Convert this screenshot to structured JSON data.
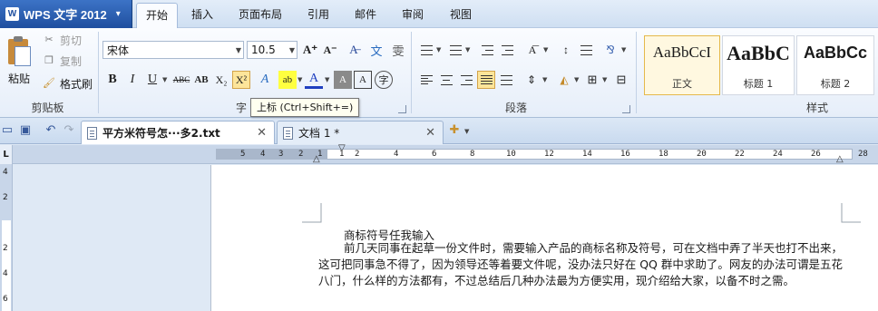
{
  "app": {
    "title": "WPS 文字 2012",
    "logo_text": "W"
  },
  "menu": {
    "tabs": [
      "开始",
      "插入",
      "页面布局",
      "引用",
      "邮件",
      "审阅",
      "视图"
    ],
    "active": "开始"
  },
  "clipboard": {
    "paste": "粘贴",
    "cut": "剪切",
    "copy": "复制",
    "format_painter": "格式刷",
    "group": "剪贴板"
  },
  "font": {
    "name": "宋体",
    "size": "10.5",
    "group": "字",
    "bold": "B",
    "italic": "I",
    "underline": "U",
    "abc": "ABC",
    "strike": "AB",
    "subscript": "X₂",
    "superscript": "X²",
    "grow": "A⁺",
    "shrink": "A⁻",
    "color_a": "A"
  },
  "paragraph": {
    "group": "段落"
  },
  "styles": {
    "group": "样式",
    "items": [
      {
        "sample": "AaBbCcI",
        "name": "正文"
      },
      {
        "sample": "AaBbC",
        "name": "标题 1"
      },
      {
        "sample": "AaBbCc",
        "name": "标题 2"
      }
    ]
  },
  "tooltip": "上标 (Ctrl+Shift+=)",
  "doc_tabs": [
    {
      "title": "平方米符号怎···多2.txt",
      "active": true
    },
    {
      "title": "文档 1 *",
      "active": false
    }
  ],
  "ruler": {
    "corner": "L",
    "numbers": [
      "5",
      "4",
      "3",
      "2",
      "1",
      "1",
      "2",
      "4",
      "6",
      "8",
      "10",
      "12",
      "14",
      "16",
      "18",
      "20",
      "22",
      "24",
      "26",
      "28"
    ],
    "vnumbers": [
      "4",
      "2",
      "2",
      "4",
      "6"
    ]
  },
  "document": {
    "title": "商标符号任我输入",
    "paragraph": "前几天同事在起草一份文件时，需要输入产品的商标名称及符号，可在文档中弄了半天也打不出来，这可把同事急不得了，因为领导还等着要文件呢，没办法只好在 QQ 群中求助了。网友的办法可谓是五花八门，什么样的方法都有，不过总结后几种办法最为方便实用，现介绍给大家，以备不时之需。"
  }
}
